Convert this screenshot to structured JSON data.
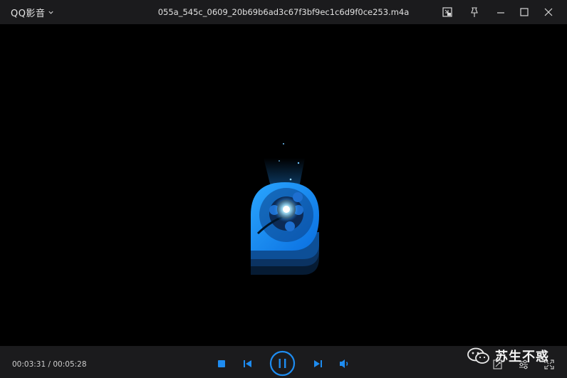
{
  "titlebar": {
    "app_name": "QQ影音",
    "file_name": "055a_545c_0609_20b69b6ad3c67f3bf9ec1c6d9f0ce253.m4a"
  },
  "playback": {
    "current_time": "00:03:31",
    "total_time": "00:05:28",
    "time_display": "00:03:31 / 00:05:28",
    "state": "playing"
  },
  "watermark": {
    "text": "苏生不惑"
  },
  "colors": {
    "accent": "#1e8cf0",
    "bar_bg": "#1b1b1d",
    "video_bg": "#000000"
  },
  "icons": {
    "app_menu": "chevron-down-icon",
    "mini_mode": "mini-mode-icon",
    "pin": "pin-icon",
    "minimize": "minimize-icon",
    "maximize": "maximize-icon",
    "close": "close-icon",
    "stop": "stop-icon",
    "previous": "previous-icon",
    "play_pause": "pause-icon",
    "next": "next-icon",
    "volume": "volume-icon",
    "screenshot": "screenshot-icon",
    "settings": "settings-icon",
    "fullscreen": "fullscreen-icon",
    "watermark": "wechat-icon"
  }
}
